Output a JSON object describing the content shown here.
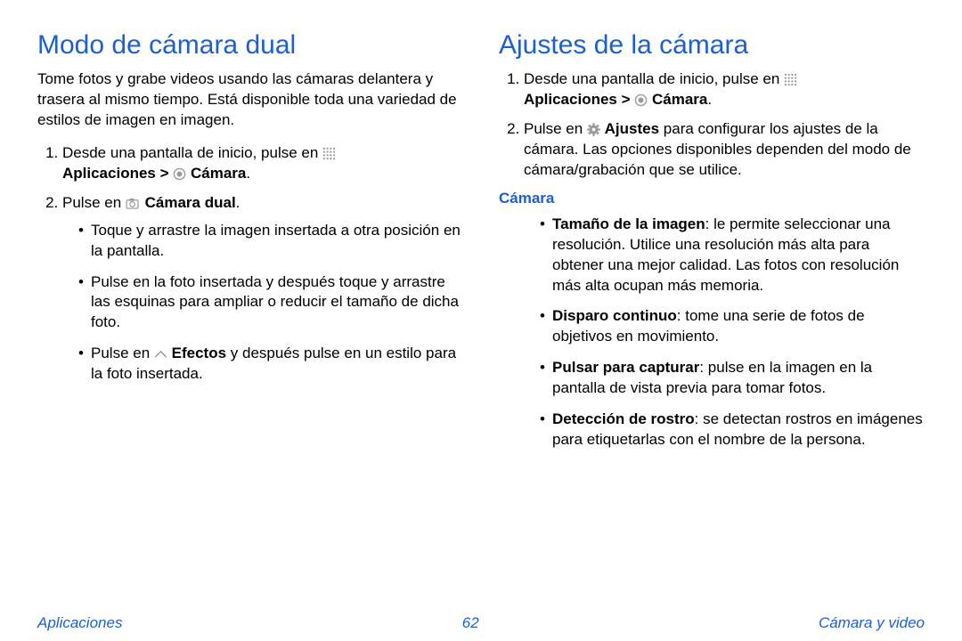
{
  "left": {
    "heading": "Modo de cámara dual",
    "intro": "Tome fotos y grabe videos usando las cámaras delantera y trasera al mismo tiempo. Está disponible toda una variedad de estilos de imagen en imagen.",
    "step1_a": "Desde una pantalla de inicio, pulse en ",
    "step1_b": "Aplicaciones > ",
    "step1_c": " Cámara",
    "step1_d": ".",
    "step2_a": "Pulse en ",
    "step2_b": " Cámara dual",
    "step2_c": ".",
    "b1": "Toque y arrastre la imagen insertada a otra posición en la pantalla.",
    "b2": "Pulse en la foto insertada y después toque y arrastre las esquinas para ampliar o reducir el tamaño de dicha foto.",
    "b3_a": "Pulse en ",
    "b3_b": " Efectos",
    "b3_c": " y después pulse en un estilo para la foto insertada."
  },
  "right": {
    "heading": "Ajustes de la cámara",
    "step1_a": "Desde una pantalla de inicio, pulse en ",
    "step1_b": "Aplicaciones > ",
    "step1_c": " Cámara",
    "step1_d": ".",
    "step2_a": "Pulse en ",
    "step2_b": " Ajustes",
    "step2_c": " para configurar los ajustes de la cámara. Las opciones disponibles dependen del modo de cámara/grabación que se utilice.",
    "section": "Cámara",
    "i1_b": "Tamaño de la imagen",
    "i1_t": ": le permite seleccionar una resolución. Utilice una resolución más alta para obtener una mejor calidad. Las fotos con resolución más alta ocupan más memoria.",
    "i2_b": "Disparo continuo",
    "i2_t": ": tome una serie de fotos de objetivos en movimiento.",
    "i3_b": "Pulsar para capturar",
    "i3_t": ": pulse en la imagen en la pantalla de vista previa para tomar fotos.",
    "i4_b": "Detección de rostro",
    "i4_t": ": se detectan rostros en imágenes para etiquetarlas con el nombre de la persona."
  },
  "footer": {
    "left": "Aplicaciones",
    "center": "62",
    "right": "Cámara y video"
  }
}
